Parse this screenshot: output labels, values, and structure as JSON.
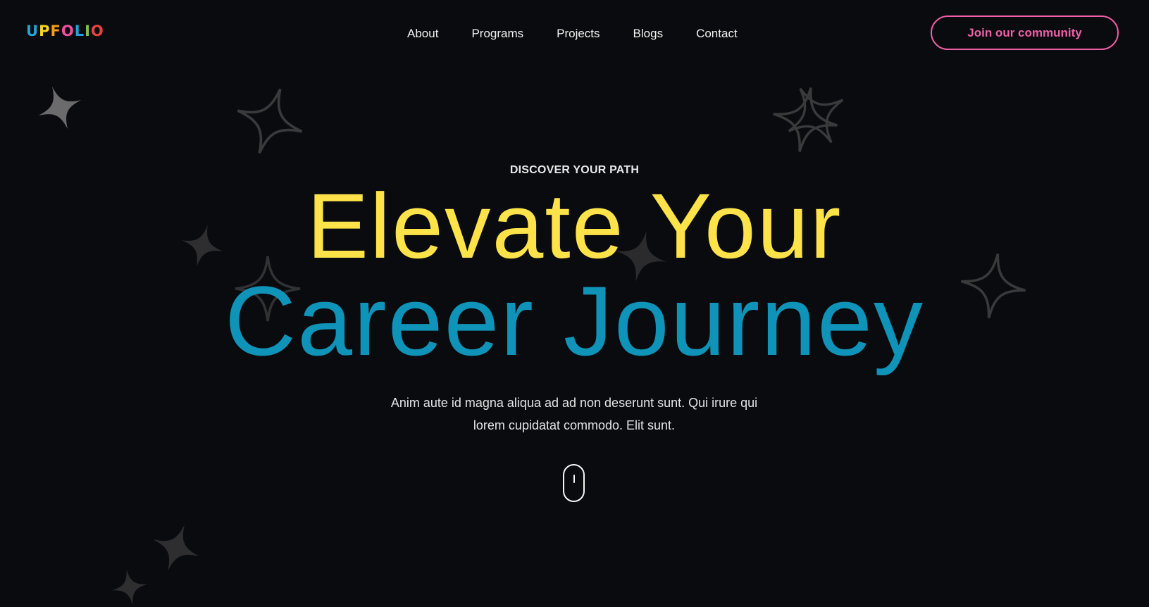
{
  "header": {
    "logo": {
      "letters": [
        {
          "char": "U",
          "color": "#1fa5d8"
        },
        {
          "char": "P",
          "color": "#f6d320"
        },
        {
          "char": "F",
          "color": "#f59a1c"
        },
        {
          "char": "O",
          "color": "#ef4fa0"
        },
        {
          "char": "L",
          "color": "#1fa5d8"
        },
        {
          "char": "I",
          "color": "#7cc443"
        },
        {
          "char": "O",
          "color": "#e8433f"
        }
      ]
    },
    "nav": [
      {
        "label": "About"
      },
      {
        "label": "Programs"
      },
      {
        "label": "Projects"
      },
      {
        "label": "Blogs"
      },
      {
        "label": "Contact"
      }
    ],
    "cta_label": "Join our community"
  },
  "hero": {
    "eyebrow": "DISCOVER YOUR PATH",
    "title_line1": "Elevate Your",
    "title_line2": "Career Journey",
    "subtitle": "Anim aute id magna aliqua ad ad non deserunt sunt. Qui irure qui lorem cupidatat commodo. Elit sunt."
  },
  "icons": {
    "scroll_indicator": "mouse-scroll-icon",
    "decorations": "sparkle-icon"
  },
  "colors": {
    "background": "#0a0b0e",
    "accent_pink": "#ef5fa7",
    "title_yellow": "#fde24a",
    "title_blue": "#1093b8"
  }
}
